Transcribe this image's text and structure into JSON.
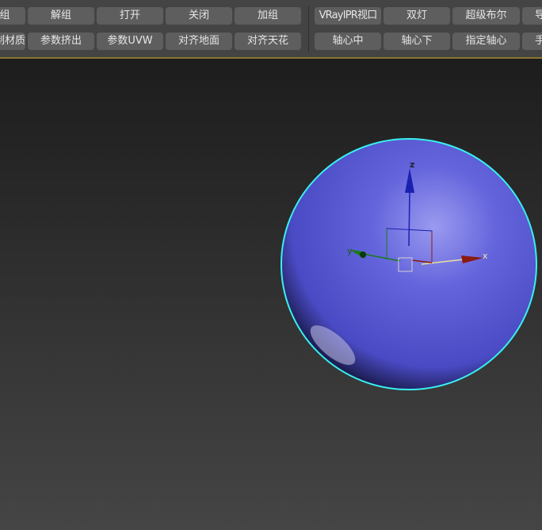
{
  "toolbar": {
    "row1": [
      "组",
      "解组",
      "打开",
      "关闭",
      "加组",
      "VRayIPR视口",
      "双灯",
      "超级布尔",
      "导"
    ],
    "row2": [
      "制材质",
      "参数挤出",
      "参数UVW",
      "对齐地面",
      "对齐天花",
      "轴心中",
      "轴心下",
      "指定轴心",
      "手"
    ]
  },
  "viewport": {
    "gizmo": {
      "x_label": "x",
      "y_label": "y",
      "z_label": "z"
    },
    "colors": {
      "sphere": "#5a5ad8",
      "selection": "#38f0f0",
      "x_axis": "#8b1a10",
      "y_axis": "#1a7a1a",
      "z_axis": "#1a20b0"
    }
  }
}
